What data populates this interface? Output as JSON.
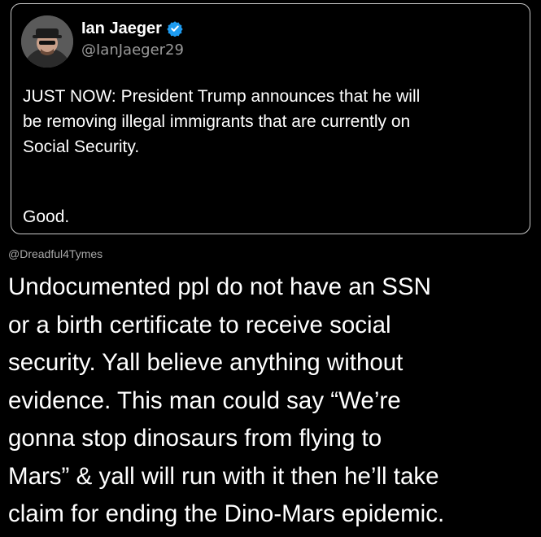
{
  "tweet": {
    "author_name": "Ian Jaeger",
    "author_handle": "@IanJaeger29",
    "verified_icon": "verified-badge-icon",
    "avatar_icon": "avatar-icon",
    "body_lines": [
      "JUST NOW: President Trump announces that he will",
      "be removing illegal immigrants that are currently on",
      "Social Security."
    ],
    "closing": "Good.",
    "colors": {
      "verified": "#1d9bf0",
      "border": "#c9c9c9",
      "handle": "#9a9a9a"
    }
  },
  "reply": {
    "handle": "@Dreadful4Tymes",
    "lines": [
      "Undocumented ppl do not have an SSN",
      "or a birth certificate to receive social",
      "security. Yall believe anything without",
      "evidence. This man could say “We’re",
      "gonna stop dinosaurs from flying to",
      "Mars” & yall will run with it then he’ll take",
      "claim for ending the Dino-Mars epidemic."
    ]
  }
}
